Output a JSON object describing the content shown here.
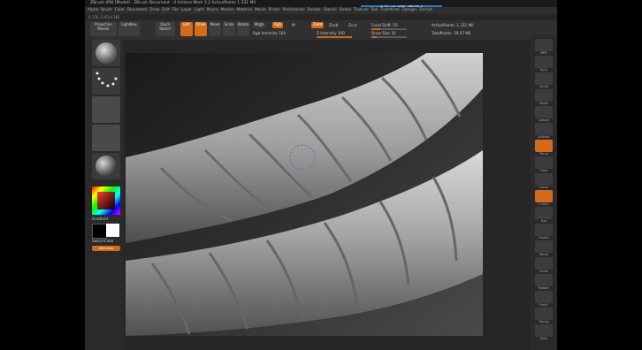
{
  "app": {
    "title": "ZBrush 4R6 [Model] · ZBrush Document · 4 Actions  Mem 3.2  ActivePoints 1.331 Mil",
    "coords": "0.176,-3.93,4.181",
    "hint": "※ Brush 설정 · 메모리 2"
  },
  "menu": {
    "items": [
      "Alpha",
      "Brush",
      "Color",
      "Document",
      "Draw",
      "Edit",
      "File",
      "Layer",
      "Light",
      "Macro",
      "Marker",
      "Material",
      "Movie",
      "Picker",
      "Preferences",
      "Render",
      "Stencil",
      "Stroke",
      "Texture",
      "Tool",
      "Transform",
      "Zplugin",
      "Zscript"
    ]
  },
  "toolbar": {
    "projection_master": "Projection Master",
    "lightbox": "LightBox",
    "quick_sketch": "Quick Sketch",
    "edit": "Edit",
    "draw": "Draw",
    "move": "Move",
    "scale": "Scale",
    "rotate": "Rotate",
    "mrgb": "Mrgb",
    "rgb": "Rgb",
    "m": "M",
    "zadd": "Zadd",
    "zsub": "Zsub",
    "zcut": "Zcut",
    "rgb_intensity": "Rgb Intensity 100",
    "z_intensity": "Z Intensity 100",
    "focal_shift": "Focal Shift -55",
    "draw_size": "Draw Size 16",
    "active_points": "ActivePoints: 1.331 Mil",
    "total_points": "TotalPoints: 19.07 Mil"
  },
  "left_shelf": {
    "gradient": "Gradient",
    "switch_color": "SwitchColor",
    "alternate": "Alternate"
  },
  "right_shelf": {
    "labels": [
      "BPR",
      "Spix",
      "Scroll",
      "Zoom",
      "Actual",
      "AAHalf",
      "Persp",
      "Floor",
      "Local",
      "L.Sym",
      "Xyz",
      "Frame",
      "Move",
      "Scale",
      "Rotate",
      "PolyF",
      "Transp",
      "Solo"
    ]
  },
  "colors": {
    "accent": "#d46a1a",
    "hint_bg": "#2f78c8",
    "viewport_bg": "#3a3a3a",
    "mesh": "#a8a8a8"
  }
}
